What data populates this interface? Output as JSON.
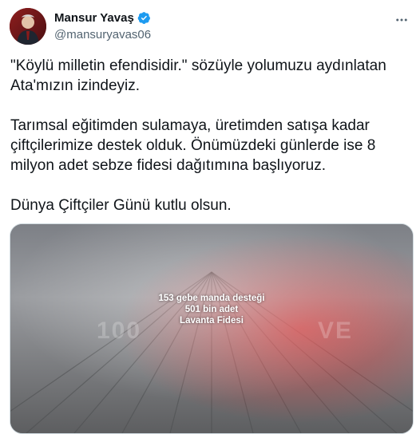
{
  "author": {
    "display_name": "Mansur Yavaş",
    "handle": "@mansuryavas06",
    "verified": true
  },
  "icons": {
    "verified": "verified-badge-icon",
    "more": "more-options-icon"
  },
  "tweet": {
    "paragraphs": [
      "\"Köylü milletin efendisidir.\" sözüyle yolumuzu aydınlatan Ata'mızın izindeyiz.",
      "Tarımsal eğitimden sulamaya, üretimden satışa kadar çiftçilerimize destek olduk. Önümüzdeki günlerde ise 8 milyon adet sebze fidesi dağıtımına başlıyoruz.",
      "Dünya Çiftçiler Günü kutlu olsun."
    ]
  },
  "media": {
    "overlay_lines": [
      "153 gebe manda desteği",
      "501 bin adet",
      "Lavanta Fidesi"
    ],
    "faded_number": "100",
    "faded_word": "VE"
  },
  "colors": {
    "text": "#0f1419",
    "secondary": "#536471",
    "verified_blue": "#1d9bf0"
  }
}
